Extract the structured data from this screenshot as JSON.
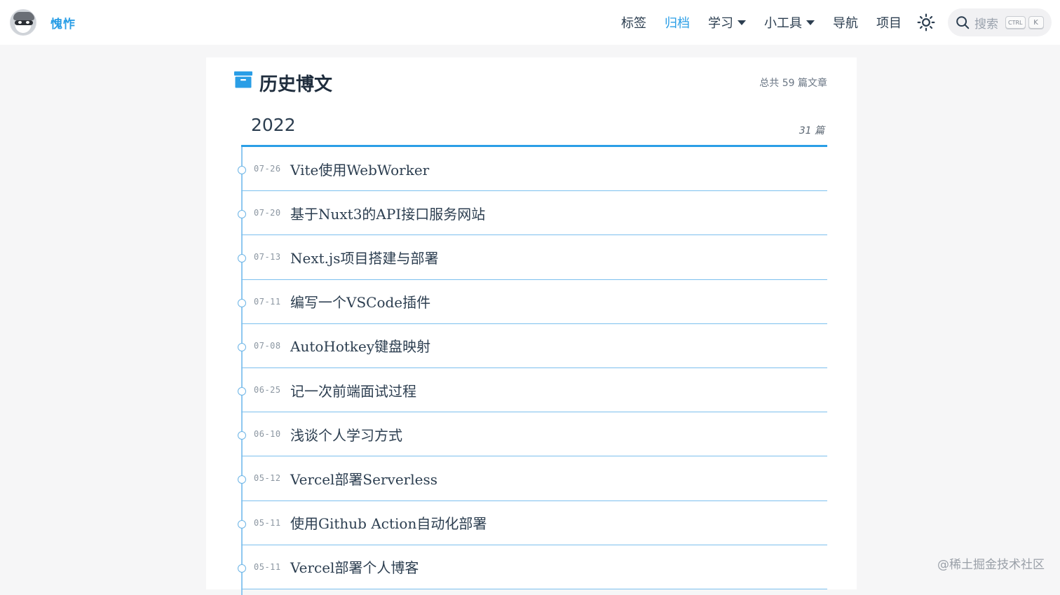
{
  "brand": {
    "name": "愧怍"
  },
  "nav": {
    "items": [
      {
        "label": "标签",
        "active": false,
        "dropdown": false
      },
      {
        "label": "归档",
        "active": true,
        "dropdown": false
      },
      {
        "label": "学习",
        "active": false,
        "dropdown": true
      },
      {
        "label": "小工具",
        "active": false,
        "dropdown": true
      },
      {
        "label": "导航",
        "active": false,
        "dropdown": false
      },
      {
        "label": "项目",
        "active": false,
        "dropdown": false
      }
    ],
    "theme_icon": "sun-icon",
    "search": {
      "placeholder": "搜索",
      "key_modifier": "CTRL",
      "key": "K"
    }
  },
  "page": {
    "title": "历史博文",
    "title_icon": "archive-box-icon",
    "total": "总共 59 篇文章"
  },
  "year_group": {
    "year": "2022",
    "count": "31 篇",
    "posts": [
      {
        "date": "07-26",
        "title": "Vite使用WebWorker"
      },
      {
        "date": "07-20",
        "title": "基于Nuxt3的API接口服务网站"
      },
      {
        "date": "07-13",
        "title": "Next.js项目搭建与部署"
      },
      {
        "date": "07-11",
        "title": "编写一个VSCode插件"
      },
      {
        "date": "07-08",
        "title": "AutoHotkey键盘映射"
      },
      {
        "date": "06-25",
        "title": "记一次前端面试过程"
      },
      {
        "date": "06-10",
        "title": "浅谈个人学习方式"
      },
      {
        "date": "05-12",
        "title": "Vercel部署Serverless"
      },
      {
        "date": "05-11",
        "title": "使用Github Action自动化部署"
      },
      {
        "date": "05-11",
        "title": "Vercel部署个人博客"
      }
    ]
  },
  "watermark": "@稀土掘金技术社区",
  "colors": {
    "accent": "#2a9ee6",
    "text": "#2c3e50",
    "background": "#f6f6f7"
  }
}
